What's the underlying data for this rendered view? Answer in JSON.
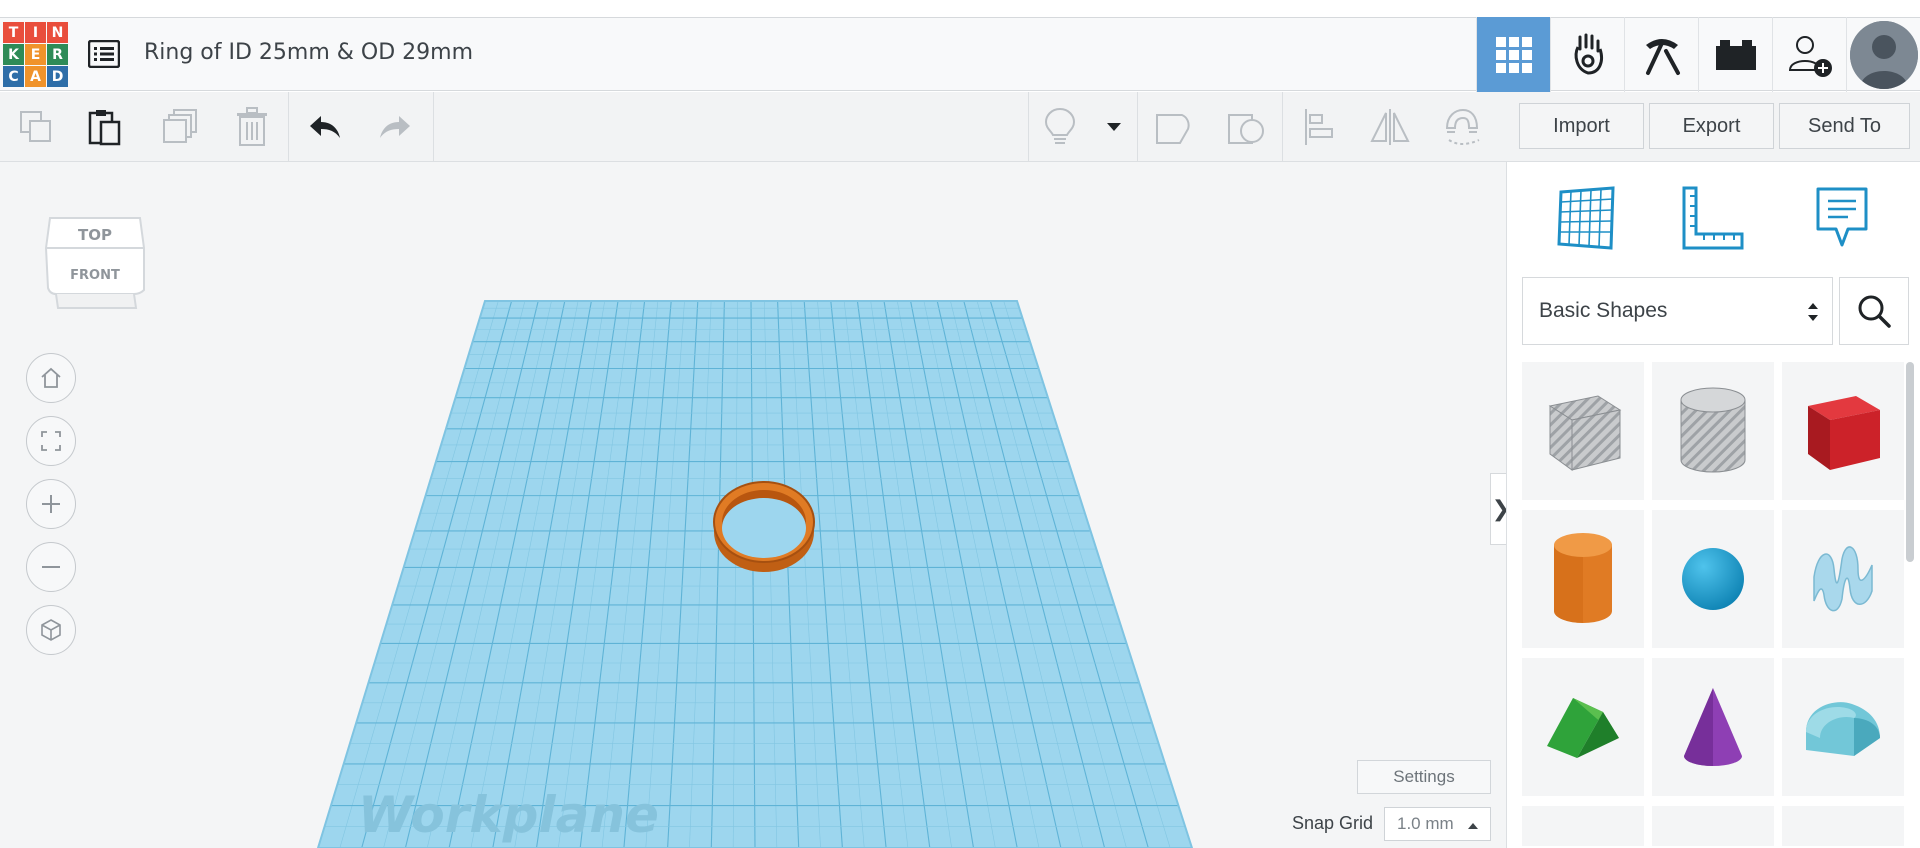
{
  "header": {
    "logo_letters": [
      "T",
      "I",
      "N",
      "K",
      "E",
      "R",
      "C",
      "A",
      "D"
    ],
    "logo_colors": [
      "#e94e3c",
      "#e94e3c",
      "#e94e3c",
      "#2e8b57",
      "#f0932b",
      "#2e8b57",
      "#2e6ea8",
      "#f0932b",
      "#2e6ea8"
    ],
    "title": "Ring of ID 25mm & OD 29mm",
    "nav": [
      {
        "name": "3d-design-view-icon",
        "active": true
      },
      {
        "name": "circuits-icon",
        "active": false
      },
      {
        "name": "minecraft-pickaxe-icon",
        "active": false
      },
      {
        "name": "bricks-icon",
        "active": false
      },
      {
        "name": "invite-user-icon",
        "active": false
      }
    ]
  },
  "toolbar": {
    "import_label": "Import",
    "export_label": "Export",
    "send_to_label": "Send To"
  },
  "viewport": {
    "viewcube_top": "TOP",
    "viewcube_front": "FRONT",
    "workplane_label": "Workplane",
    "settings_label": "Settings",
    "snap_grid_label": "Snap Grid",
    "snap_grid_value": "1.0 mm",
    "collapse_glyph": "❯",
    "accent_color": "#5b9bd5",
    "grid_color": "#7cc8e6",
    "ring_color": "#e07b24"
  },
  "panel": {
    "shape_category": "Basic Shapes",
    "shapes": [
      {
        "name": "box-hole-shape"
      },
      {
        "name": "cylinder-hole-shape"
      },
      {
        "name": "box-shape"
      },
      {
        "name": "cylinder-shape"
      },
      {
        "name": "sphere-shape"
      },
      {
        "name": "scribble-shape"
      },
      {
        "name": "roof-shape"
      },
      {
        "name": "cone-shape"
      },
      {
        "name": "round-roof-shape"
      }
    ]
  }
}
